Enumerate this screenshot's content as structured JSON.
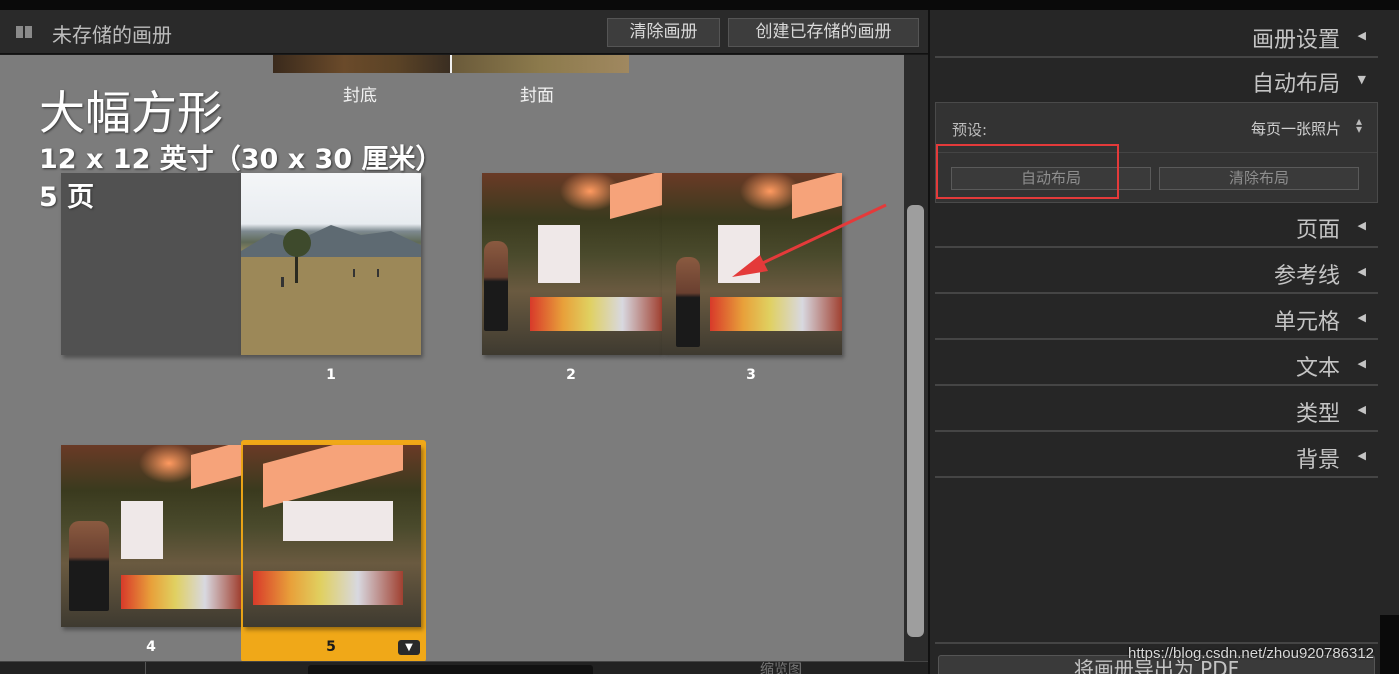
{
  "header": {
    "title": "未存储的画册",
    "clear_book": "清除画册",
    "create_saved_book": "创建已存储的画册"
  },
  "covers": {
    "back_label": "封底",
    "front_label": "封面"
  },
  "book": {
    "size": "大幅方形",
    "dimensions": "12 x 12 英寸（30 x 30 厘米）",
    "pages": "5 页"
  },
  "pages": [
    {
      "number": "1"
    },
    {
      "number": "2"
    },
    {
      "number": "3"
    },
    {
      "number": "4"
    },
    {
      "number": "5",
      "selected": true
    }
  ],
  "bottom_bar": {
    "label": "缩览图"
  },
  "right_panel": {
    "sections": {
      "book_settings": "画册设置",
      "auto_layout": "自动布局",
      "page": "页面",
      "guides": "参考线",
      "cells": "单元格",
      "text": "文本",
      "type": "类型",
      "background": "背景"
    },
    "auto_layout": {
      "preset_label": "预设:",
      "preset_value": "每页一张照片",
      "auto_layout_button": "自动布局",
      "clear_layout_button": "清除布局"
    },
    "export_button": "将画册导出为 PDF"
  },
  "watermark": "https://blog.csdn.net/zhou920786312",
  "colors": {
    "selection": "#f0a818",
    "annotation": "#e43a3a",
    "canvas": "#7c7c7c",
    "panel": "#262626"
  }
}
